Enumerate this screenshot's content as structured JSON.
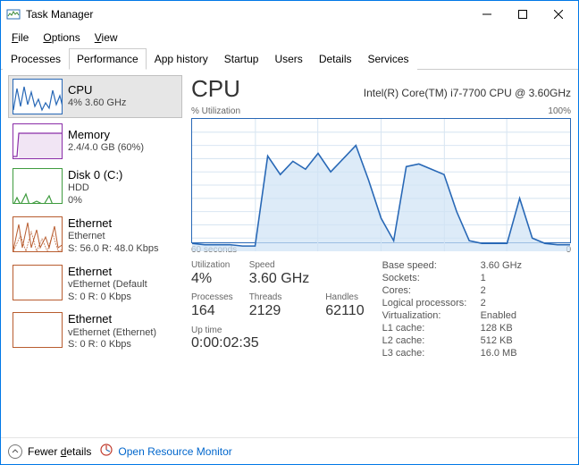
{
  "window": {
    "title": "Task Manager"
  },
  "menu": {
    "file": "File",
    "options": "Options",
    "view": "View"
  },
  "tabs": {
    "processes": "Processes",
    "performance": "Performance",
    "apphistory": "App history",
    "startup": "Startup",
    "users": "Users",
    "details": "Details",
    "services": "Services"
  },
  "sidebar": [
    {
      "title": "CPU",
      "sub1": "4% 3.60 GHz",
      "sub2": "",
      "color": "#2868b6"
    },
    {
      "title": "Memory",
      "sub1": "2.4/4.0 GB (60%)",
      "sub2": "",
      "color": "#8a2da8"
    },
    {
      "title": "Disk 0 (C:)",
      "sub1": "HDD",
      "sub2": "0%",
      "color": "#3f9b3f"
    },
    {
      "title": "Ethernet",
      "sub1": "Ethernet",
      "sub2": "S: 56.0 R: 48.0 Kbps",
      "color": "#b85c2f"
    },
    {
      "title": "Ethernet",
      "sub1": "vEthernet (Default ",
      "sub2": "S: 0 R: 0 Kbps",
      "color": "#b85c2f"
    },
    {
      "title": "Ethernet",
      "sub1": "vEthernet (Ethernet)",
      "sub2": "S: 0 R: 0 Kbps",
      "color": "#b85c2f"
    }
  ],
  "main": {
    "title": "CPU",
    "model": "Intel(R) Core(TM) i7-7700 CPU @ 3.60GHz",
    "chartLabelLeft": "% Utilization",
    "chartLabelRight": "100%",
    "timeLeft": "60 seconds",
    "timeRight": "0",
    "stats": {
      "utilization": {
        "label": "Utilization",
        "value": "4%"
      },
      "speed": {
        "label": "Speed",
        "value": "3.60 GHz"
      },
      "processes": {
        "label": "Processes",
        "value": "164"
      },
      "threads": {
        "label": "Threads",
        "value": "2129"
      },
      "handles": {
        "label": "Handles",
        "value": "62110"
      },
      "uptime": {
        "label": "Up time",
        "value": "0:00:02:35"
      }
    },
    "details": {
      "basespeed": {
        "label": "Base speed:",
        "value": "3.60 GHz"
      },
      "sockets": {
        "label": "Sockets:",
        "value": "1"
      },
      "cores": {
        "label": "Cores:",
        "value": "2"
      },
      "logical": {
        "label": "Logical processors:",
        "value": "2"
      },
      "virtualization": {
        "label": "Virtualization:",
        "value": "Enabled"
      },
      "l1": {
        "label": "L1 cache:",
        "value": "128 KB"
      },
      "l2": {
        "label": "L2 cache:",
        "value": "512 KB"
      },
      "l3": {
        "label": "L3 cache:",
        "value": "16.0 MB"
      }
    }
  },
  "footer": {
    "fewer": "Fewer details",
    "orm": "Open Resource Monitor"
  },
  "chart_data": {
    "type": "line",
    "title": "% Utilization",
    "xlabel": "60 seconds → 0",
    "ylabel": "% Utilization",
    "ylim": [
      0,
      100
    ],
    "x_seconds_ago": [
      60,
      58,
      56,
      54,
      52,
      50,
      48,
      46,
      44,
      42,
      40,
      38,
      36,
      34,
      32,
      30,
      28,
      26,
      24,
      22,
      20,
      18,
      16,
      14,
      12,
      10,
      8,
      6,
      4,
      2,
      0
    ],
    "values": [
      6,
      5,
      5,
      5,
      4,
      4,
      72,
      58,
      68,
      62,
      74,
      60,
      70,
      80,
      54,
      25,
      8,
      64,
      66,
      62,
      58,
      30,
      8,
      6,
      6,
      6,
      40,
      10,
      6,
      5,
      5
    ]
  }
}
